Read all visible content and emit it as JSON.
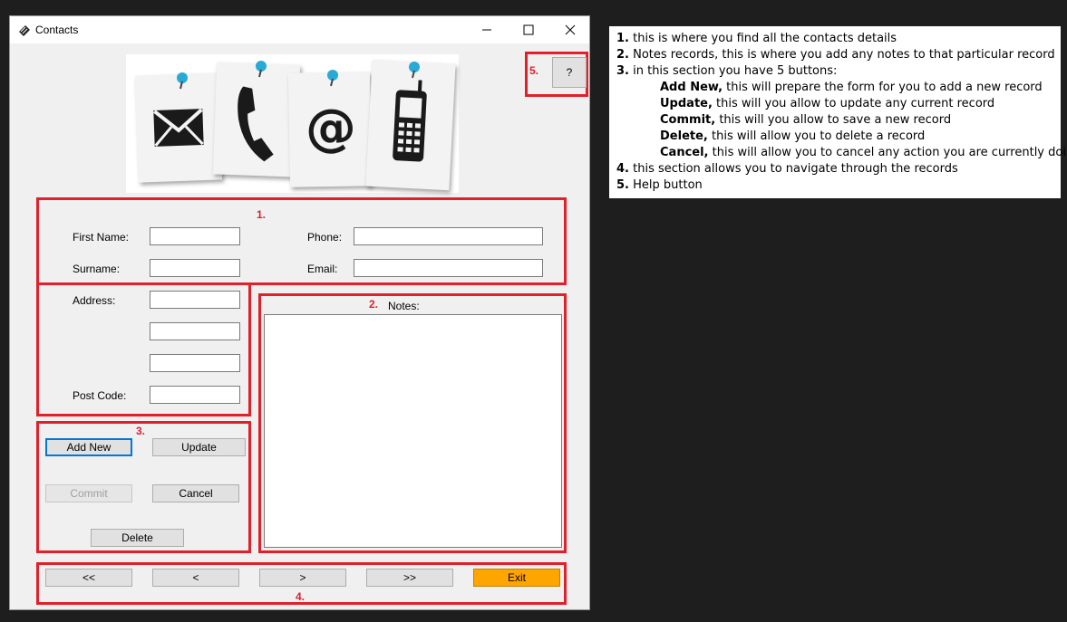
{
  "window": {
    "title": "Contacts"
  },
  "help_button": {
    "label": "?"
  },
  "annotations": {
    "a1": "1.",
    "a2": "2.",
    "a3": "3.",
    "a4": "4.",
    "a5": "5."
  },
  "form": {
    "first_name_label": "First Name:",
    "surname_label": "Surname:",
    "address_label": "Address:",
    "post_code_label": "Post Code:",
    "phone_label": "Phone:",
    "email_label": "Email:",
    "notes_label": "Notes:",
    "first_name": "",
    "surname": "",
    "address1": "",
    "address2": "",
    "address3": "",
    "post_code": "",
    "phone": "",
    "email": "",
    "notes": ""
  },
  "buttons": {
    "add_new": "Add New",
    "update": "Update",
    "commit": "Commit",
    "cancel": "Cancel",
    "delete": "Delete"
  },
  "nav": {
    "first": "<<",
    "prev": "<",
    "next": ">",
    "last": ">>",
    "exit": "Exit"
  },
  "colors": {
    "annotation_red": "#e0202a",
    "exit_orange": "#ffa500",
    "focus_blue": "#0078d7"
  },
  "help_text": {
    "l1_num": "1.",
    "l1": " this is where you find all the contacts details",
    "l2_num": "2.",
    "l2": " Notes records, this is where you add any notes to that particular record",
    "l3_num": "3.",
    "l3": " in this section you have 5 buttons:",
    "b1_name": "Add New,",
    "b1": " this will prepare the form for you to add a new record",
    "b2_name": "Update,",
    "b2": " this will you allow to update any current record",
    "b3_name": "Commit,",
    "b3": " this will you allow to save a new record",
    "b4_name": "Delete,",
    "b4": " this will allow you to delete a record",
    "b5_name": "Cancel,",
    "b5": " this will allow you to cancel any action you are currently doing",
    "l4_num": "4.",
    "l4": " this section allows you to navigate through the records",
    "l5_num": "5.",
    "l5": " Help button"
  }
}
